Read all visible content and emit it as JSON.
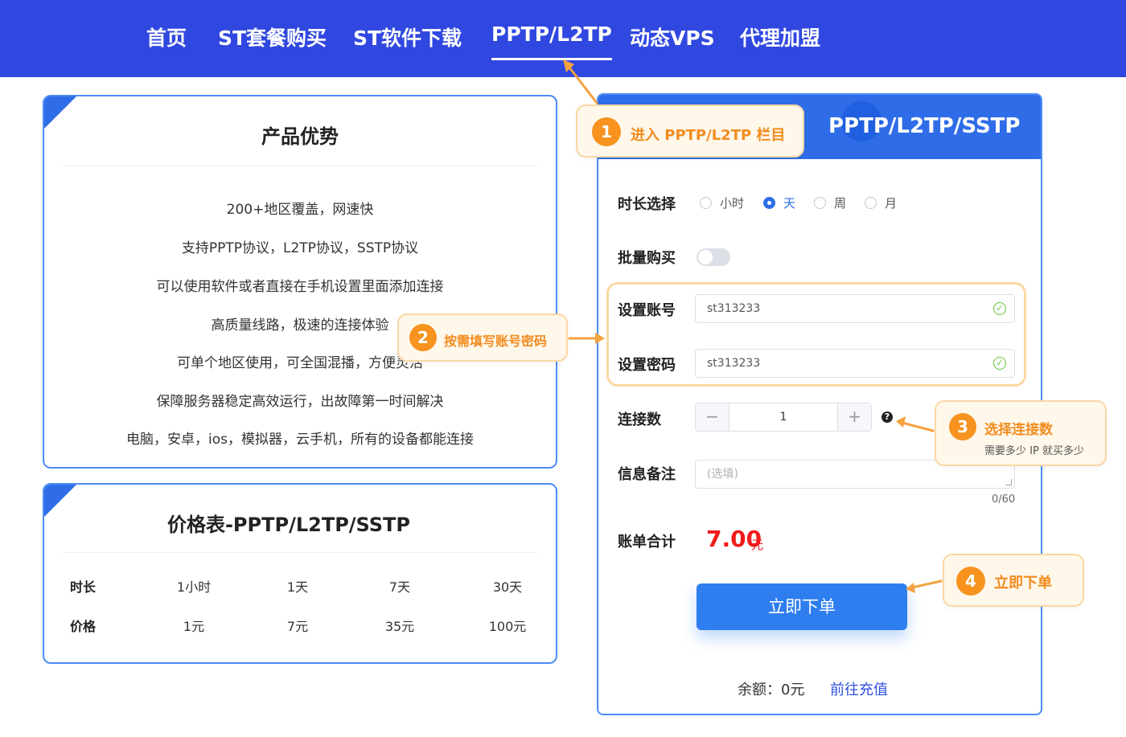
{
  "nav": {
    "items": [
      "首页",
      "ST套餐购买",
      "ST软件下载",
      "PPTP/L2TP",
      "动态VPS",
      "代理加盟"
    ],
    "active_index": 3
  },
  "advantages": {
    "title": "产品优势",
    "lines": [
      "200+地区覆盖，网速快",
      "支持PPTP协议，L2TP协议，SSTP协议",
      "可以使用软件或者直接在手机设置里面添加连接",
      "高质量线路，极速的连接体验",
      "可单个地区使用，可全国混播，方便灵活",
      "保障服务器稳定高效运行，出故障第一时间解决",
      "电脑，安卓，ios，模拟器，云手机，所有的设备都能连接"
    ]
  },
  "price_table": {
    "title": "价格表-PPTP/L2TP/SSTP",
    "row_duration_label": "时长",
    "row_price_label": "价格",
    "durations": [
      "1小时",
      "1天",
      "7天",
      "30天"
    ],
    "prices": [
      "1元",
      "7元",
      "35元",
      "100元"
    ]
  },
  "panel": {
    "title": "PPTP/L2TP/SSTP",
    "duration_label": "时长选择",
    "duration_options": [
      "小时",
      "天",
      "周",
      "月"
    ],
    "duration_selected_index": 1,
    "bulk_label": "批量购买",
    "bulk_on": false,
    "account_label": "设置账号",
    "account_value": "st313233",
    "password_label": "设置密码",
    "password_value": "st313233",
    "connections_label": "连接数",
    "connections_value": "1",
    "minus": "−",
    "plus": "+",
    "help": "?",
    "note_label": "信息备注",
    "note_placeholder": "(选填)",
    "note_counter": "0/60",
    "total_label": "账单合计",
    "total_value": "7.00",
    "total_unit": "元",
    "buy_button": "立即下单",
    "balance_text": "余额：0元",
    "recharge_link": "前往充值"
  },
  "callouts": [
    {
      "num": "1",
      "text": "进入 PPTP/L2TP 栏目"
    },
    {
      "num": "2",
      "text": "按需填写账号密码"
    },
    {
      "num": "3",
      "text": "选择连接数",
      "sub": "需要多少 IP 就买多少"
    },
    {
      "num": "4",
      "text": "立即下单"
    }
  ],
  "colors": {
    "nav_bg": "#3048e0",
    "accent": "#2f6de8",
    "callout_orange": "#f7931e",
    "total_red": "#f01a1a"
  }
}
